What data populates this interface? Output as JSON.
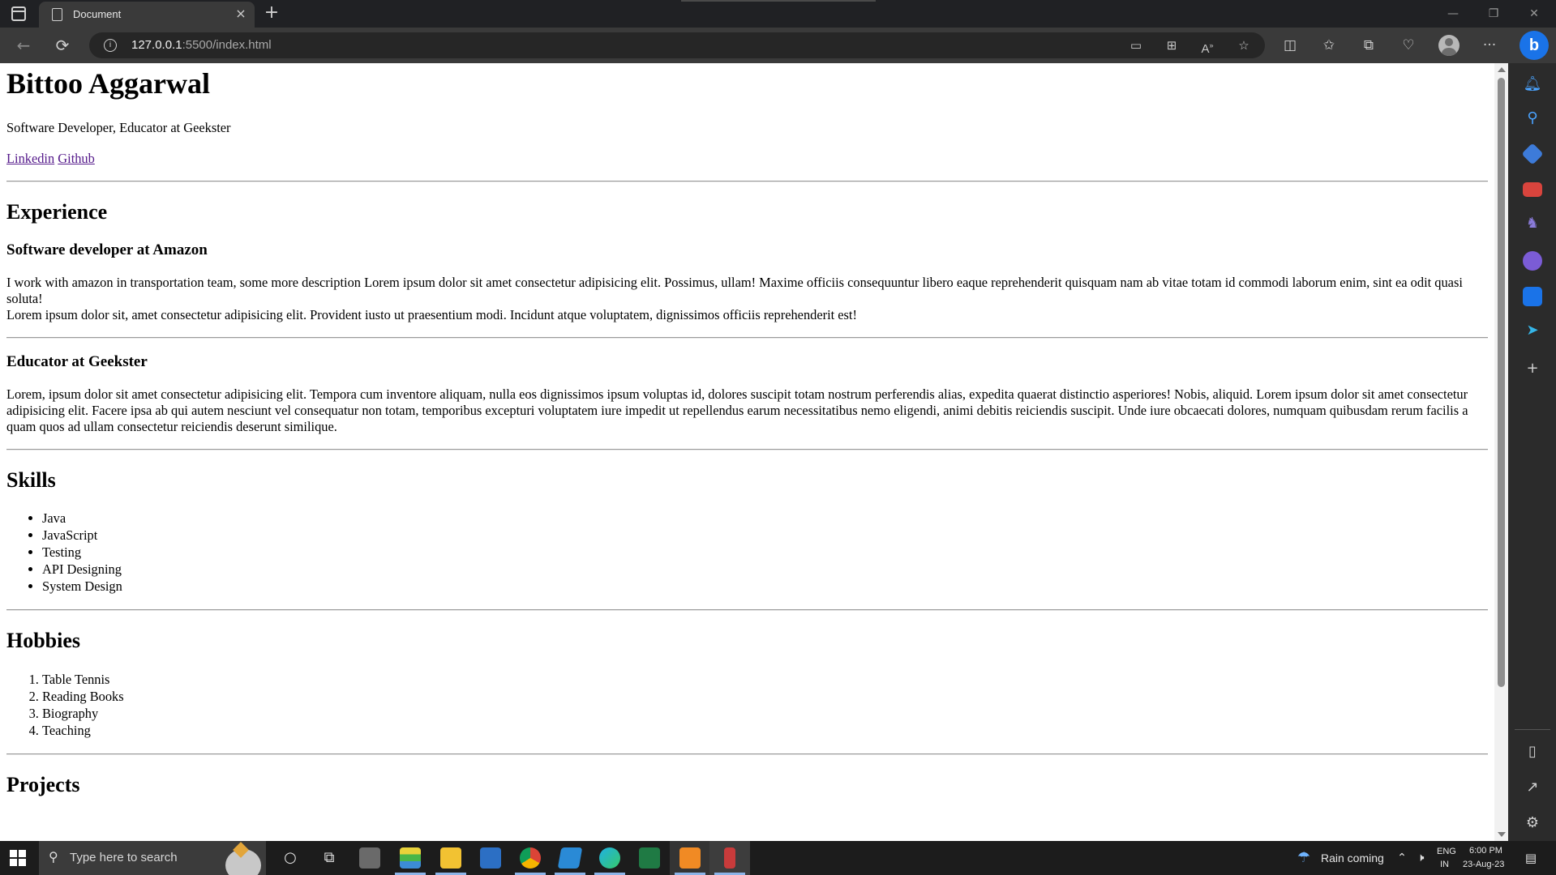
{
  "browser": {
    "tab_title": "Document",
    "tab_close": "×",
    "new_tab": "+",
    "url_host": "127.0.0.1",
    "url_rest": ":5500/index.html",
    "window_minimize": "—",
    "window_restore": "❐",
    "window_close": "✕",
    "bing_label": "b",
    "more_label": "···"
  },
  "page": {
    "name": "Bittoo Aggarwal",
    "tagline": "Software Developer, Educator at Geekster",
    "links": [
      "Linkedin",
      "Github"
    ],
    "experience": {
      "heading": "Experience",
      "jobs": [
        {
          "title": "Software developer at Amazon",
          "description": "I work with amazon in transportation team, some more description Lorem ipsum dolor sit amet consectetur adipisicing elit. Possimus, ullam! Maxime officiis consequuntur libero eaque reprehenderit quisquam nam ab vitae totam id commodi laborum enim, sint ea odit quasi soluta!",
          "description2": "Lorem ipsum dolor sit, amet consectetur adipisicing elit. Provident iusto ut praesentium modi. Incidunt atque voluptatem, dignissimos officiis reprehenderit est!"
        },
        {
          "title": "Educator at Geekster",
          "description": "Lorem, ipsum dolor sit amet consectetur adipisicing elit. Tempora cum inventore aliquam, nulla eos dignissimos ipsum voluptas id, dolores suscipit totam nostrum perferendis alias, expedita quaerat distinctio asperiores! Nobis, aliquid. Lorem ipsum dolor sit amet consectetur adipisicing elit. Facere ipsa ab qui autem nesciunt vel consequatur non totam, temporibus excepturi voluptatem iure impedit ut repellendus earum necessitatibus nemo eligendi, animi debitis reiciendis suscipit. Unde iure obcaecati dolores, numquam quibusdam rerum facilis a quam quos ad ullam consectetur reiciendis deserunt similique."
        }
      ]
    },
    "skills": {
      "heading": "Skills",
      "items": [
        "Java",
        "JavaScript",
        "Testing",
        "API Designing",
        "System Design"
      ]
    },
    "hobbies": {
      "heading": "Hobbies",
      "items": [
        "Table Tennis",
        "Reading Books",
        "Biography",
        "Teaching"
      ]
    },
    "projects": {
      "heading": "Projects"
    }
  },
  "taskbar": {
    "search_placeholder": "Type here to search",
    "weather": "Rain coming",
    "lang_top": "ENG",
    "lang_bottom": "IN",
    "time": "6:00 PM",
    "date": "23-Aug-23"
  },
  "colors": {
    "link_visited": "#551a8b",
    "bing_blue": "#1a73e8",
    "taskbar_active": "#8cb4e8"
  }
}
